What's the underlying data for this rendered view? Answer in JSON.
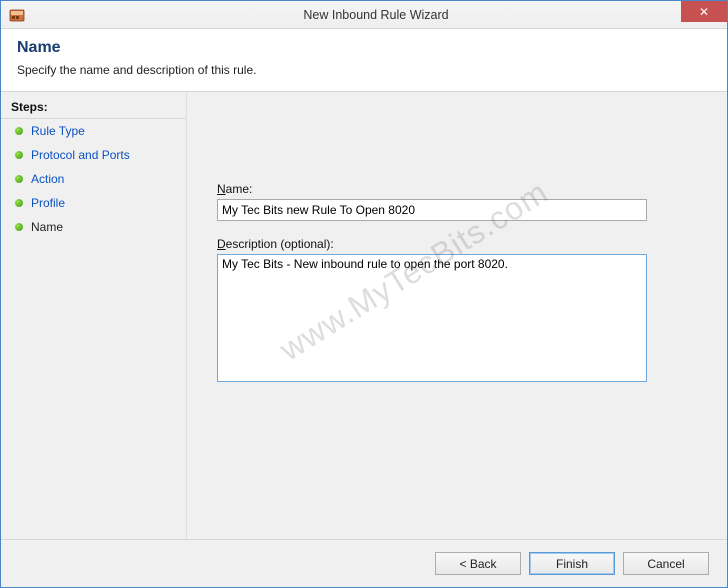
{
  "window": {
    "title": "New Inbound Rule Wizard",
    "close_glyph": "✕"
  },
  "header": {
    "title": "Name",
    "subtitle": "Specify the name and description of this rule."
  },
  "sidebar": {
    "steps_label": "Steps:",
    "items": [
      {
        "label": "Rule Type",
        "current": false
      },
      {
        "label": "Protocol and Ports",
        "current": false
      },
      {
        "label": "Action",
        "current": false
      },
      {
        "label": "Profile",
        "current": false
      },
      {
        "label": "Name",
        "current": true
      }
    ]
  },
  "form": {
    "name_label_pre": "N",
    "name_label_post": "ame:",
    "name_value": "My Tec Bits new Rule To Open 8020",
    "desc_label_pre": "D",
    "desc_label_post": "escription (optional):",
    "desc_value": "My Tec Bits - New inbound rule to open the port 8020."
  },
  "buttons": {
    "back": "< Back",
    "finish": "Finish",
    "cancel": "Cancel"
  },
  "watermark": "www.MyTecBits.com"
}
